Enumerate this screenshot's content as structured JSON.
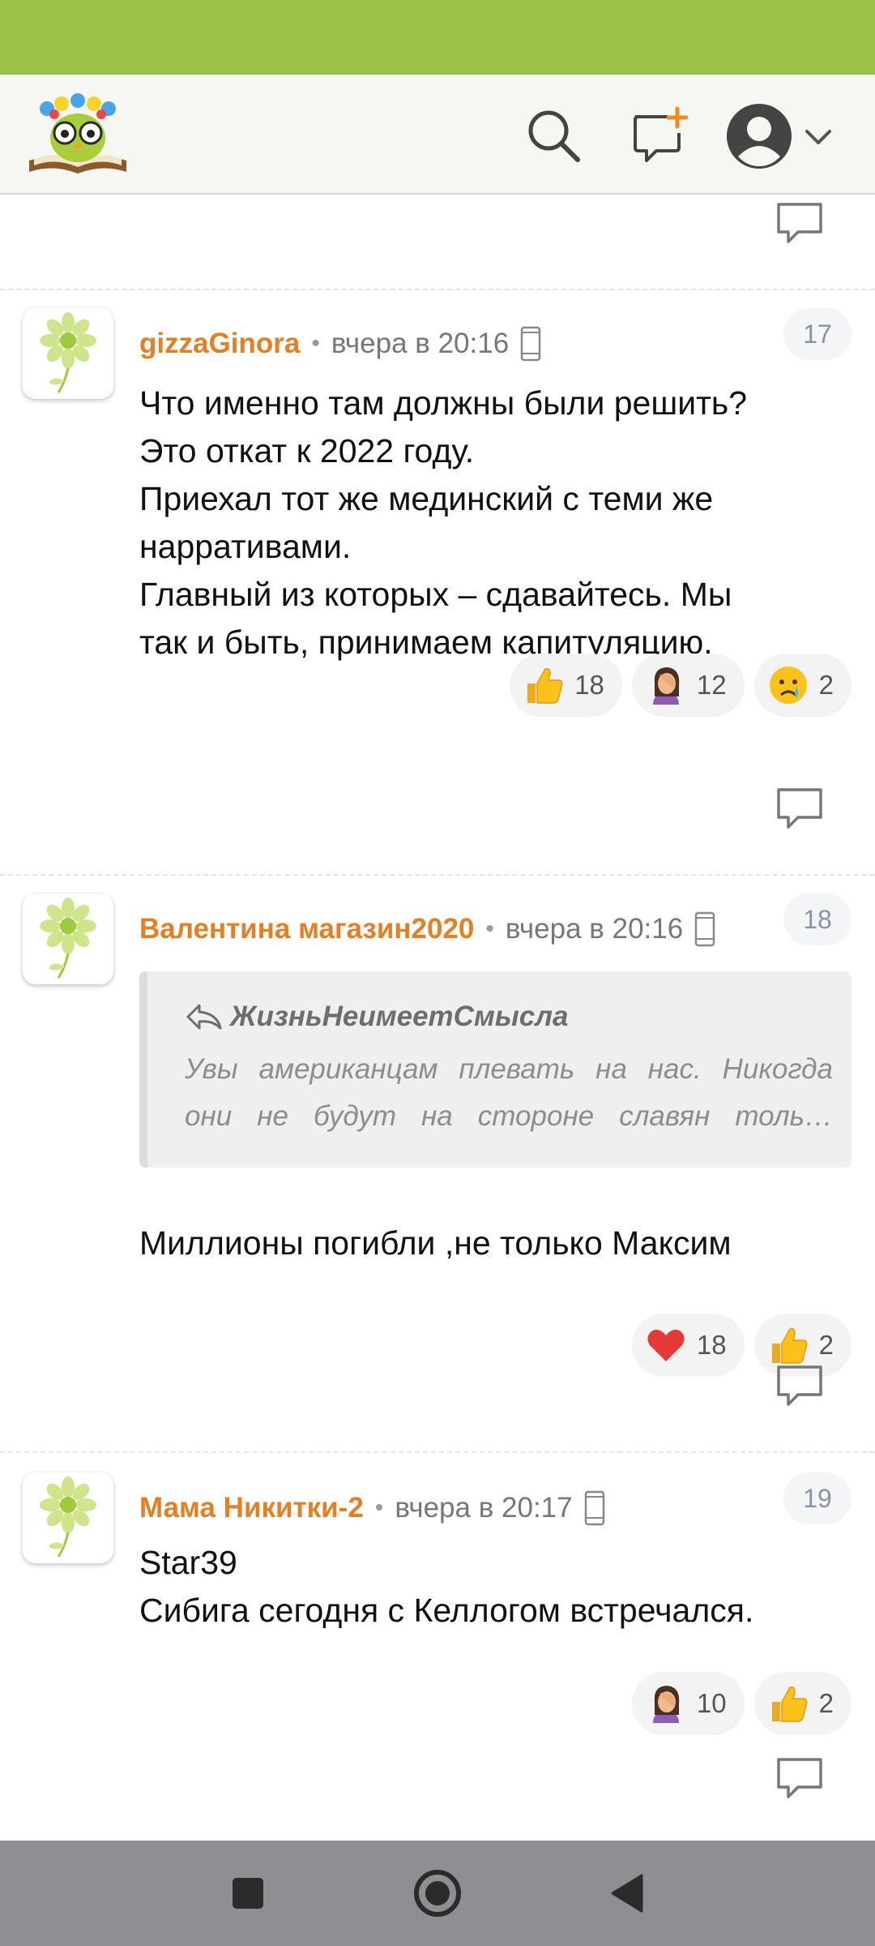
{
  "colors": {
    "status_bar": "#9cc148",
    "author": "#e67e22",
    "header_bg": "#f6f6f3",
    "nav_bar": "#8e8e93"
  },
  "header": {
    "logo_icon": "owl-book-logo-icon",
    "search_icon": "search-icon",
    "new_post_icon": "new-post-icon",
    "profile_icon": "user-avatar-icon",
    "dropdown_icon": "chevron-down-icon"
  },
  "comments": [
    {
      "author": "gizzaGinora",
      "dot": "•",
      "time": "вчера в 20:16",
      "number": "17",
      "lines": [
        "Что именно там должны были решить?",
        "Это откат к 2022 году.",
        "Приехал тот же мединский с теми же",
        "нарративами.",
        "Главный из которых – сдавайтесь. Мы",
        "так и быть, принимаем капитуляцию."
      ],
      "reactions": [
        {
          "emoji": "thumbs-up",
          "count": "18"
        },
        {
          "emoji": "facepalm",
          "count": "12"
        },
        {
          "emoji": "crying-face",
          "count": "2"
        }
      ]
    },
    {
      "author": "Валентина магазин2020",
      "dot": "•",
      "time": "вчера в 20:16",
      "number": "18",
      "quote": {
        "author": "ЖизньНеимеетСмысла",
        "line1": "Увы американцам плевать на нас. Никогда",
        "line2": "они не будут на стороне славян толь…"
      },
      "lines": [
        "Миллионы погибли ,не только Максим"
      ],
      "reactions": [
        {
          "emoji": "red-heart",
          "count": "18"
        },
        {
          "emoji": "thumbs-up",
          "count": "2"
        }
      ]
    },
    {
      "author": "Мама Никитки-2",
      "dot": "•",
      "time": "вчера в 20:17",
      "number": "19",
      "lines": [
        "Star39",
        "Сибига сегодня с Келлогом встречался."
      ],
      "reactions": [
        {
          "emoji": "facepalm",
          "count": "10"
        },
        {
          "emoji": "thumbs-up",
          "count": "2"
        }
      ]
    }
  ],
  "navigation": {
    "recents_icon": "square-recents-icon",
    "home_icon": "circle-home-icon",
    "back_icon": "triangle-back-icon"
  }
}
